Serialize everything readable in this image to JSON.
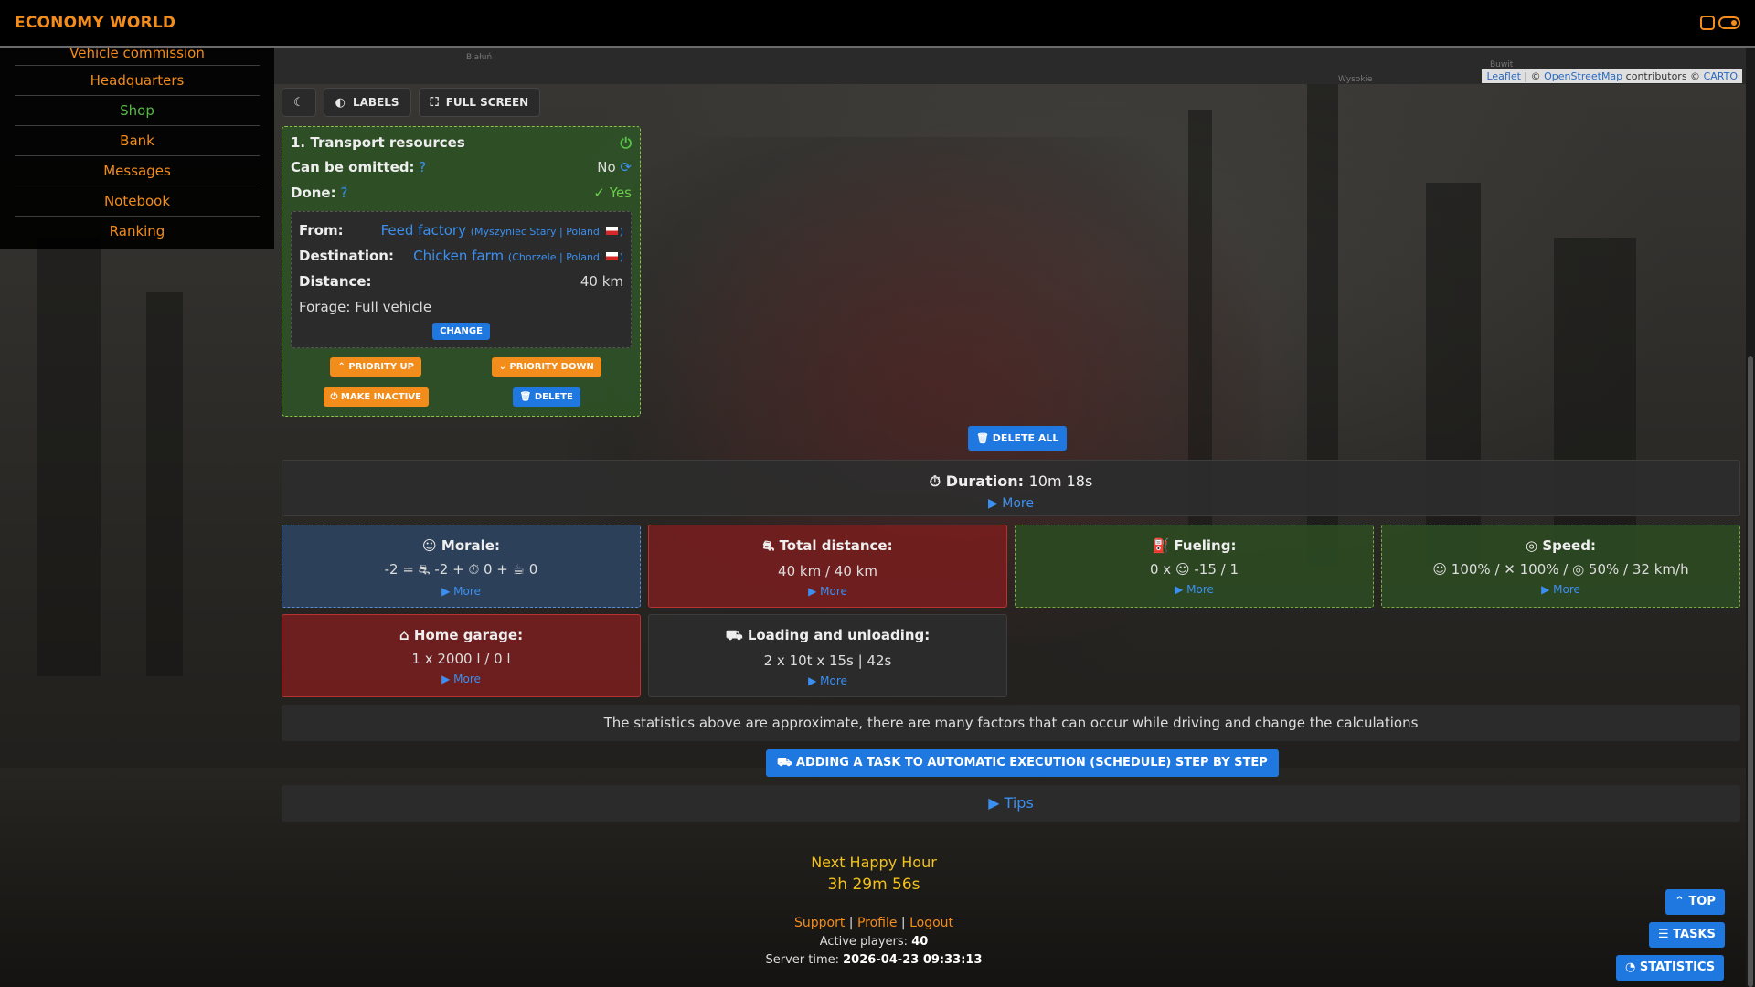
{
  "header": {
    "brand": "ECONOMY WORLD"
  },
  "menu": {
    "items": [
      {
        "label": "Vehicle commission"
      },
      {
        "label": "Headquarters"
      },
      {
        "label": "Shop"
      },
      {
        "label": "Bank"
      },
      {
        "label": "Messages"
      },
      {
        "label": "Notebook"
      },
      {
        "label": "Ranking"
      }
    ]
  },
  "map": {
    "attribution_leaflet": "Leaflet",
    "attribution_sep1": "|",
    "attribution_copy": "©",
    "attribution_osm": "OpenStreetMap",
    "attribution_contrib": "contributors ©",
    "attribution_carto": "CARTO",
    "label_a": "Białuń",
    "label_b": "Wysokie",
    "label_c": "Buwit"
  },
  "toolbar": {
    "labels": "LABELS",
    "fullscreen": "FULL SCREEN"
  },
  "task": {
    "title": "1. Transport resources",
    "omit_label": "Can be omitted:",
    "omit_help": "?",
    "omit_value": "No",
    "done_label": "Done:",
    "done_help": "?",
    "done_value": "Yes",
    "from_label": "From:",
    "from_name": "Feed factory",
    "from_loc": "(Myszyniec Stary",
    "from_country": "Poland",
    "from_close": ")",
    "dest_label": "Destination:",
    "dest_name": "Chicken farm",
    "dest_loc": "(Chorzele",
    "dest_country": "Poland",
    "dest_close": ")",
    "distance_label": "Distance:",
    "distance_value": "40 km",
    "forage": "Forage: Full vehicle",
    "change": "CHANGE",
    "priority_up": "PRIORITY UP",
    "priority_down": "PRIORITY DOWN",
    "make_inactive": "MAKE INACTIVE",
    "delete": "DELETE"
  },
  "delete_all": "DELETE ALL",
  "duration": {
    "label": "Duration:",
    "value": "10m 18s",
    "more": "More"
  },
  "stats": {
    "morale": {
      "label": "Morale:",
      "value": "-2 = ⛐ -2 + ⏱ 0 + ☕ 0",
      "more": "More"
    },
    "distance": {
      "label": "Total distance:",
      "value": "40 km / 40 km",
      "more": "More"
    },
    "fueling": {
      "label": "Fueling:",
      "value": "0 x ☺ -15 / 1",
      "more": "More"
    },
    "speed": {
      "label": "Speed:",
      "value": "☺ 100% / ✕ 100% / ◎ 50% / 32 km/h",
      "more": "More"
    },
    "garage": {
      "label": "Home garage:",
      "value": "1 x 2000 l / 0 l",
      "more": "More"
    },
    "loading": {
      "label": "Loading and unloading:",
      "value": "2 x  10t x 15s | 42s",
      "more": "More"
    }
  },
  "note": "The statistics above are approximate, there are many factors that can occur while driving and change the calculations",
  "schedule_btn": "ADDING A TASK TO AUTOMATIC EXECUTION (SCHEDULE) STEP BY STEP",
  "tips": "Tips",
  "footer": {
    "hh_label": "Next Happy Hour",
    "hh_time": "3h 29m 56s",
    "support": "Support",
    "profile": "Profile",
    "logout": "Logout",
    "sep": "|",
    "players_label": "Active players:",
    "players_value": "40",
    "server_label": "Server time:",
    "server_value": "2026-04-23 09:33:13"
  },
  "float": {
    "top": "TOP",
    "tasks": "TASKS",
    "statistics": "STATISTICS"
  },
  "colors": {
    "accent": "#f28c1a",
    "link": "#3b8ff0",
    "primary": "#1f78e0",
    "success": "#57c246"
  }
}
